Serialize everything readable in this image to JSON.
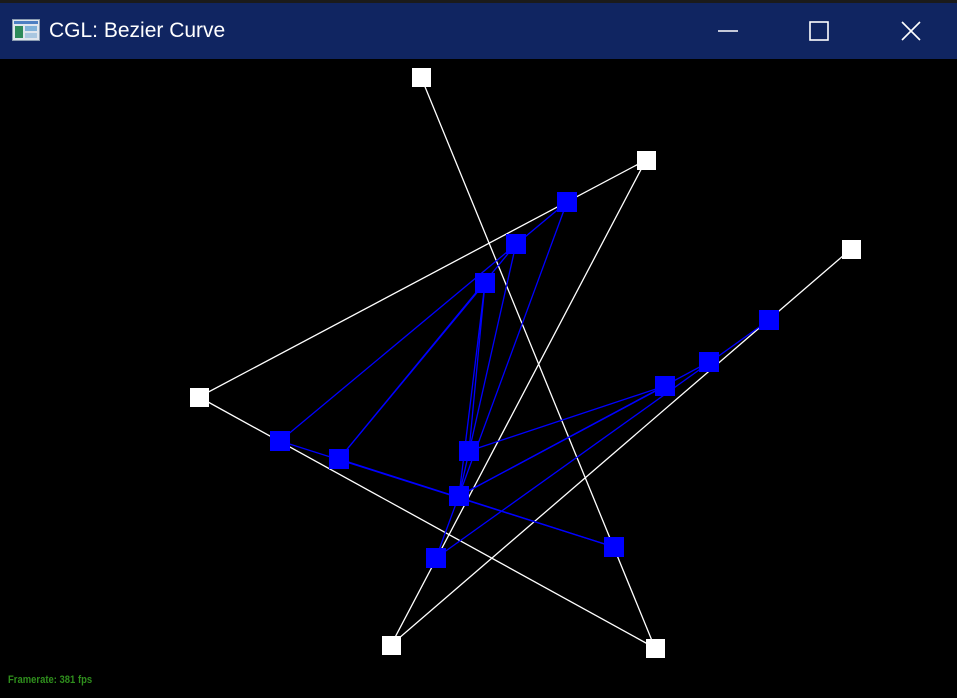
{
  "window": {
    "title": "CGL: Bezier Curve",
    "icon": "app-window-icon",
    "controls": {
      "minimize_icon": "minimize-icon",
      "maximize_icon": "maximize-icon",
      "close_icon": "close-icon"
    }
  },
  "colors": {
    "titlebar": "#102561",
    "canvas_background": "#000000",
    "control_polygon": "#ffffff",
    "construction": "#0000ff",
    "framerate_text": "#2f8f1d"
  },
  "status": {
    "framerate": "Framerate: 381 fps"
  }
}
